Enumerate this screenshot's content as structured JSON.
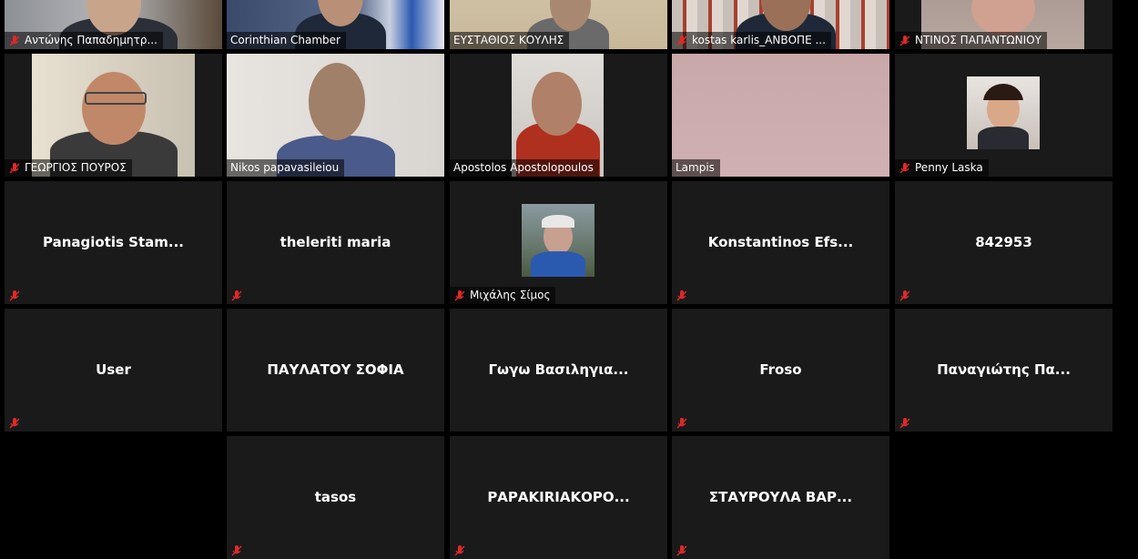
{
  "participants": [
    {
      "name": "Αντώνης Παπαδημητρ...",
      "muted": true,
      "video": true,
      "active": false
    },
    {
      "name": "Corinthian Chamber",
      "muted": false,
      "video": true,
      "active": false
    },
    {
      "name": "ΕΥΣΤΑΘΙΟΣ ΚΟΥΛΗΣ",
      "muted": false,
      "video": true,
      "active": true
    },
    {
      "name": "kostas karlis_ΑΝΒΟΠΕ ...",
      "muted": true,
      "video": true,
      "active": false
    },
    {
      "name": "ΝΤΙΝΟΣ ΠΑΠΑΝΤΩΝΙΟΥ",
      "muted": true,
      "video": true,
      "active": false
    },
    {
      "name": "ΓΕΩΡΓΙΟΣ ΠΟΥΡΟΣ",
      "muted": true,
      "video": true,
      "active": false
    },
    {
      "name": "Nikos papavasileiou",
      "muted": false,
      "video": true,
      "active": false
    },
    {
      "name": "Apostolos Apostolopoulos",
      "muted": false,
      "video": true,
      "active": false
    },
    {
      "name": "Lampis",
      "muted": false,
      "video": true,
      "active": false
    },
    {
      "name": "Penny Laska",
      "muted": true,
      "video": true,
      "active": false
    },
    {
      "name": "Panagiotis  Stam...",
      "muted": true,
      "video": false,
      "active": false
    },
    {
      "name": "theleriti maria",
      "muted": true,
      "video": false,
      "active": false
    },
    {
      "name": "Μιχάλης Σίμος",
      "muted": true,
      "video": true,
      "active": false
    },
    {
      "name": "Konstantinos  Efs...",
      "muted": true,
      "video": false,
      "active": false
    },
    {
      "name": "842953",
      "muted": true,
      "video": false,
      "active": false
    },
    {
      "name": "User",
      "muted": true,
      "video": false,
      "active": false
    },
    {
      "name": "ΠΑΥΛΑΤΟΥ ΣΟΦΙΑ",
      "muted": false,
      "video": false,
      "active": false
    },
    {
      "name": "Γωγω  Βασιληγια...",
      "muted": false,
      "video": false,
      "active": false
    },
    {
      "name": "Froso",
      "muted": true,
      "video": false,
      "active": false
    },
    {
      "name": "Παναγιώτης Πα...",
      "muted": true,
      "video": false,
      "active": false
    },
    {
      "name": "tasos",
      "muted": true,
      "video": false,
      "active": false
    },
    {
      "name": "ΡΑΡΑΚΙRΙΑΚΟΡΟ...",
      "muted": true,
      "video": false,
      "active": false
    },
    {
      "name": "ΣΤΑΥΡΟΥΛΑ  ΒΑΡ...",
      "muted": true,
      "video": false,
      "active": false
    }
  ],
  "colors": {
    "tile": "#1a1a1a",
    "active_border": "#d7e05a",
    "muted_icon": "#e02828"
  }
}
